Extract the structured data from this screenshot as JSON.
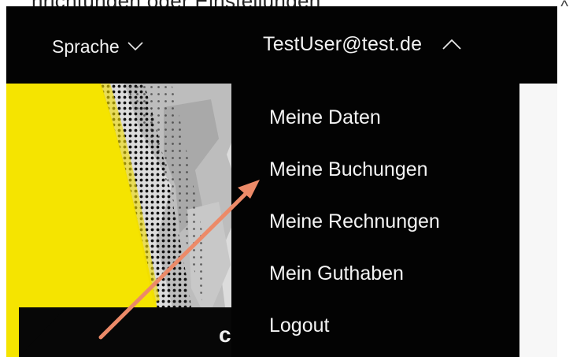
{
  "top_text": "hrichtungen oder Einstellungen",
  "corner_glyph": "^",
  "header": {
    "language_label": "Sprache",
    "user_label": "TestUser@test.de"
  },
  "menu": {
    "items": [
      {
        "label": "Meine Daten"
      },
      {
        "label": "Meine Buchungen"
      },
      {
        "label": "Meine Rechnungen"
      },
      {
        "label": "Mein Guthaben"
      },
      {
        "label": "Logout"
      }
    ]
  },
  "bottom_glyph": "c",
  "colors": {
    "header_bg": "#030303",
    "menu_bg": "#030303",
    "text": "#f2f2f2",
    "hero_yellow": "#f5e400",
    "arrow": "#ec8a68"
  },
  "icons": {
    "language_chevron": "chevron-down-icon",
    "user_chevron": "chevron-up-icon",
    "annotation_arrow": "arrow-icon"
  }
}
